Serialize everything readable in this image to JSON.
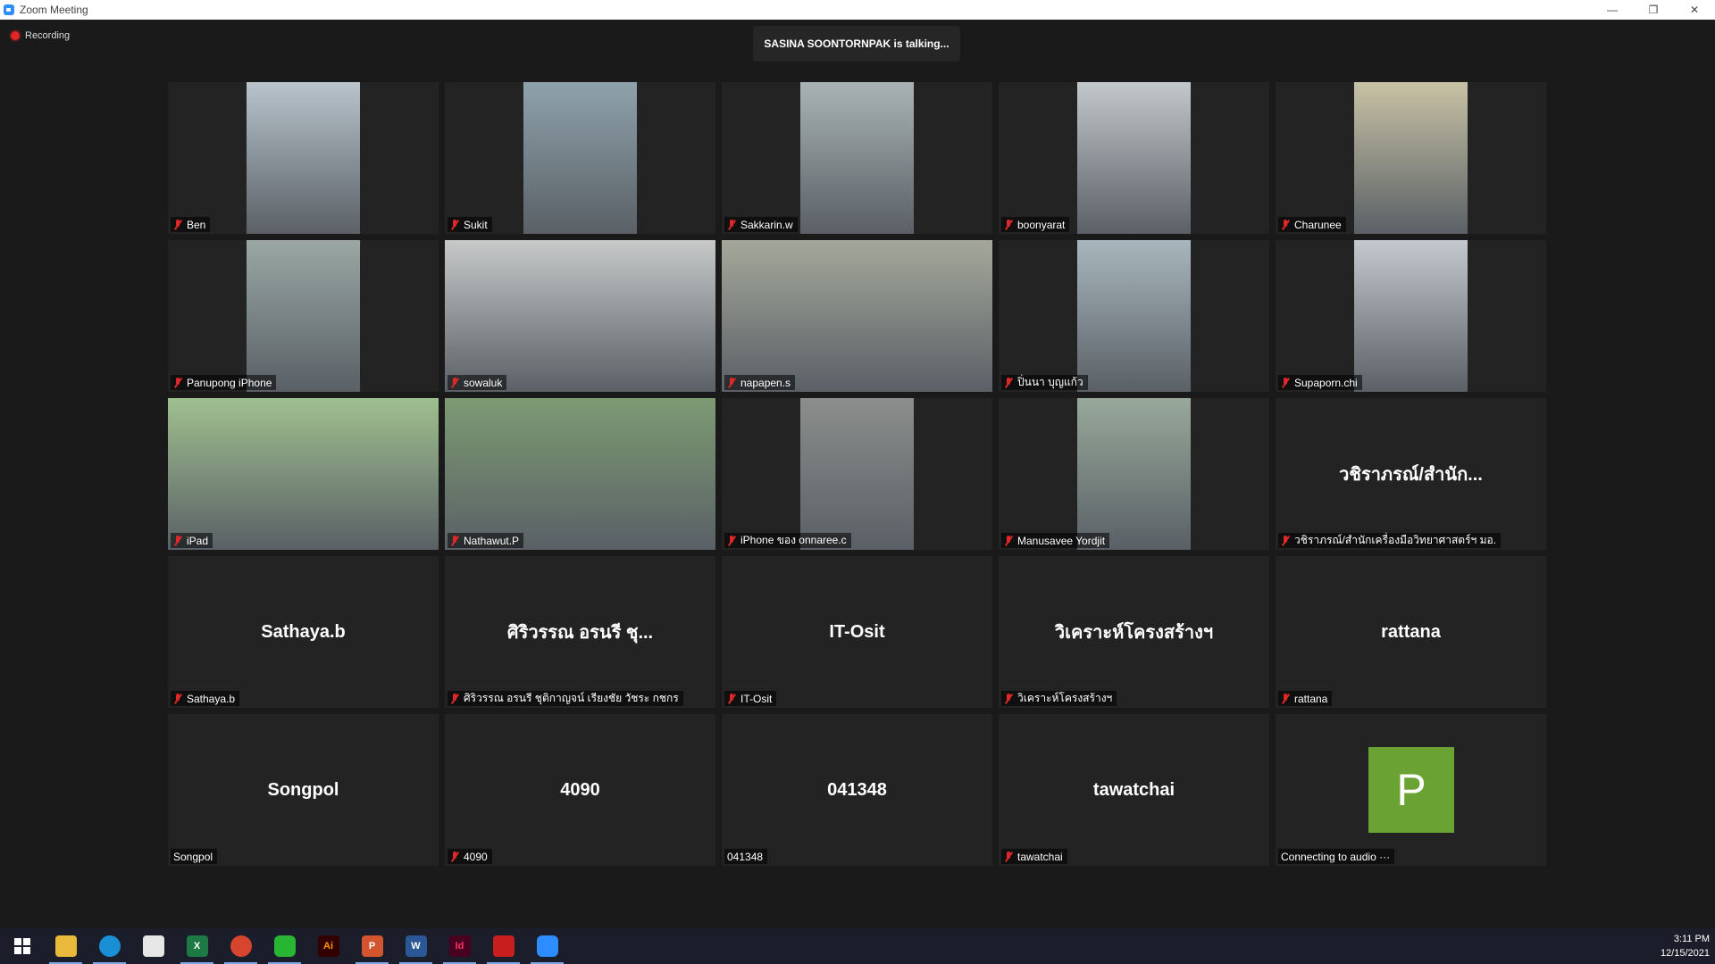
{
  "window": {
    "title": "Zoom Meeting"
  },
  "meeting": {
    "recording_label": "Recording",
    "talking_banner": "SASINA SOONTORNPAK is talking..."
  },
  "participants": [
    {
      "label": "Ben",
      "muted": true
    },
    {
      "label": "Sukit",
      "muted": true
    },
    {
      "label": "Sakkarin.w",
      "muted": true
    },
    {
      "label": "boonyarat",
      "muted": true
    },
    {
      "label": "Charunee",
      "muted": true
    },
    {
      "label": "Panupong iPhone",
      "muted": true
    },
    {
      "label": "sowaluk",
      "muted": true
    },
    {
      "label": "napapen.s",
      "muted": true
    },
    {
      "label": "ปิ่นนา บุญแก้ว",
      "muted": true
    },
    {
      "label": "Supaporn.chi",
      "muted": true
    },
    {
      "label": "iPad",
      "muted": true
    },
    {
      "label": "Nathawut.P",
      "muted": true
    },
    {
      "label": "iPhone ของ onnaree.c",
      "muted": true
    },
    {
      "label": "Manusavee Yordjit",
      "muted": true
    },
    {
      "label": "วชิราภรณ์/สำนักเครื่องมือวิทยาศาสตร์ฯ มอ.",
      "display_name": "วชิราภรณ์/สำนัก...",
      "muted": true
    },
    {
      "label": "Sathaya.b",
      "display_name": "Sathaya.b",
      "muted": true
    },
    {
      "label": "ศิริวรรณ อรนรี ชุติกาญจน์ เรียงชัย วัชระ กชกร",
      "display_name": "ศิริวรรณ อรนรี ชุ...",
      "muted": true
    },
    {
      "label": "IT-Osit",
      "display_name": "IT-Osit",
      "muted": true
    },
    {
      "label": "วิเคราะห์โครงสร้างฯ",
      "display_name": "วิเคราะห์โครงสร้างฯ",
      "muted": true
    },
    {
      "label": "rattana",
      "display_name": "rattana",
      "muted": true
    },
    {
      "label": "Songpol",
      "display_name": "Songpol",
      "muted": false
    },
    {
      "label": "4090",
      "display_name": "4090",
      "muted": true
    },
    {
      "label": "041348",
      "display_name": "041348",
      "muted": false
    },
    {
      "label": "tawatchai",
      "display_name": "tawatchai",
      "muted": true
    },
    {
      "label": "Connecting to audio ···",
      "avatar_letter": "P",
      "avatar_color": "#6aa233",
      "muted": false
    }
  ],
  "taskbar": {
    "icons": [
      "windows-start-icon",
      "file-explorer-icon",
      "edge-icon",
      "qr-app-icon",
      "excel-icon",
      "chrome-icon",
      "line-icon",
      "illustrator-icon",
      "powerpoint-icon",
      "word-icon",
      "indesign-icon",
      "acrobat-icon",
      "zoom-icon"
    ],
    "icon_text": {
      "illustrator": "Ai",
      "indesign": "Id",
      "word": "W",
      "excel": "X",
      "powerpoint": "P"
    },
    "time": "3:11 PM",
    "date": "12/15/2021"
  },
  "colors": {
    "muted_red": "#e02828",
    "zoom_blue": "#2d8cff",
    "tile_bg": "#232323"
  }
}
